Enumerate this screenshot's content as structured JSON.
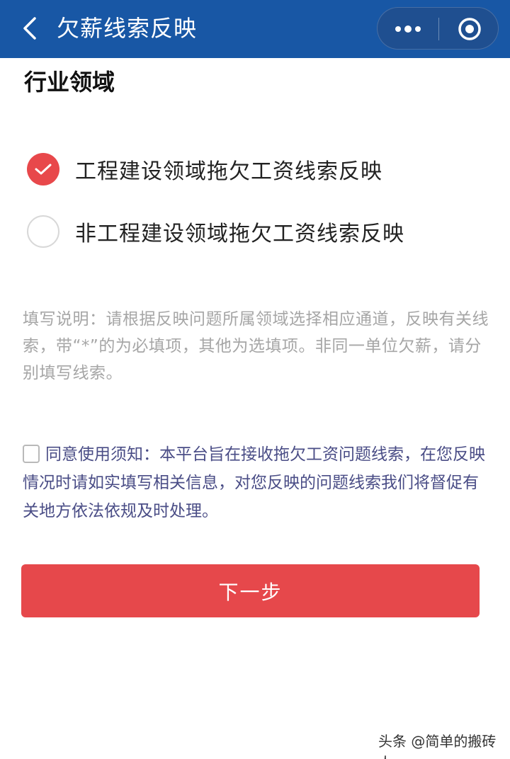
{
  "header": {
    "title": "欠薪线索反映",
    "back_icon": "chevron-left-icon",
    "more_icon": "more-dots-icon",
    "close_icon": "target-circle-icon",
    "bg_color": "#1857a5"
  },
  "section": {
    "title": "行业领域"
  },
  "options": [
    {
      "label": "工程建设领域拖欠工资线索反映",
      "checked": true
    },
    {
      "label": "非工程建设领域拖欠工资线索反映",
      "checked": false
    }
  ],
  "hint": {
    "text": "填写说明：请根据反映问题所属领域选择相应通道，反映有关线索，带“*”的为必填项，其他为选填项。非同一单位欠薪，请分别填写线索。"
  },
  "agreement": {
    "checked": false,
    "text": "同意使用须知：本平台旨在接收拖欠工资问题线索，在您反映情况时请如实填写相关信息，对您反映的问题线索我们将督促有关地方依法依规及时处理。"
  },
  "next_button": {
    "label": "下一步",
    "color": "#e6484b"
  },
  "watermark": {
    "text": "头条 @简单的搬砖人"
  }
}
